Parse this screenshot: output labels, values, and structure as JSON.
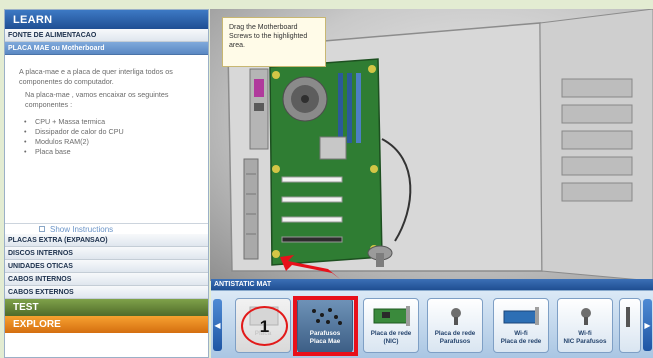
{
  "sidebar": {
    "learn": "LEARN",
    "sections_top": [
      {
        "label": "FONTE DE ALIMENTACAO",
        "active": false
      },
      {
        "label": "PLACA MAE ou Motherboard",
        "active": true
      }
    ],
    "content": {
      "para1": "A placa-mae e a placa de quer interliga todos os componentes do computador.",
      "para2": "Na placa-mae , vamos encaixar os seguintes componentes :",
      "items": [
        "CPU + Massa termica",
        "Dissipador de calor do CPU",
        "Modulos RAM(2)",
        "Placa base"
      ]
    },
    "show_instructions": "Show Instructions",
    "sections_bottom": [
      "PLACAS EXTRA (EXPANSAO)",
      "DISCOS INTERNOS",
      "UNIDADES OTICAS",
      "CABOS INTERNOS",
      "CABOS EXTERNOS"
    ],
    "test": "TEST",
    "explore": "EXPLORE"
  },
  "scene": {
    "tooltip": "Drag the Motherboard Screws to the highlighted area."
  },
  "tray": {
    "title": "ANTISTATIC MAT",
    "tiles": [
      {
        "line1": "Placa",
        "line2": "",
        "state": "disabled"
      },
      {
        "line1": "Parafusos",
        "line2": "Placa Mae",
        "state": "selected"
      },
      {
        "line1": "Placa de rede",
        "line2": "(NIC)",
        "state": "normal"
      },
      {
        "line1": "Placa de rede",
        "line2": "Parafusos",
        "state": "normal"
      },
      {
        "line1": "Wi-fi",
        "line2": "Placa de rede",
        "state": "normal"
      },
      {
        "line1": "Wi-fi",
        "line2": "NIC Parafusos",
        "state": "normal"
      }
    ],
    "step_number": "1",
    "left_arrow": "◀",
    "right_arrow": "▶"
  },
  "colors": {
    "highlight": "#e8101a",
    "accent": "#1f4e92"
  }
}
